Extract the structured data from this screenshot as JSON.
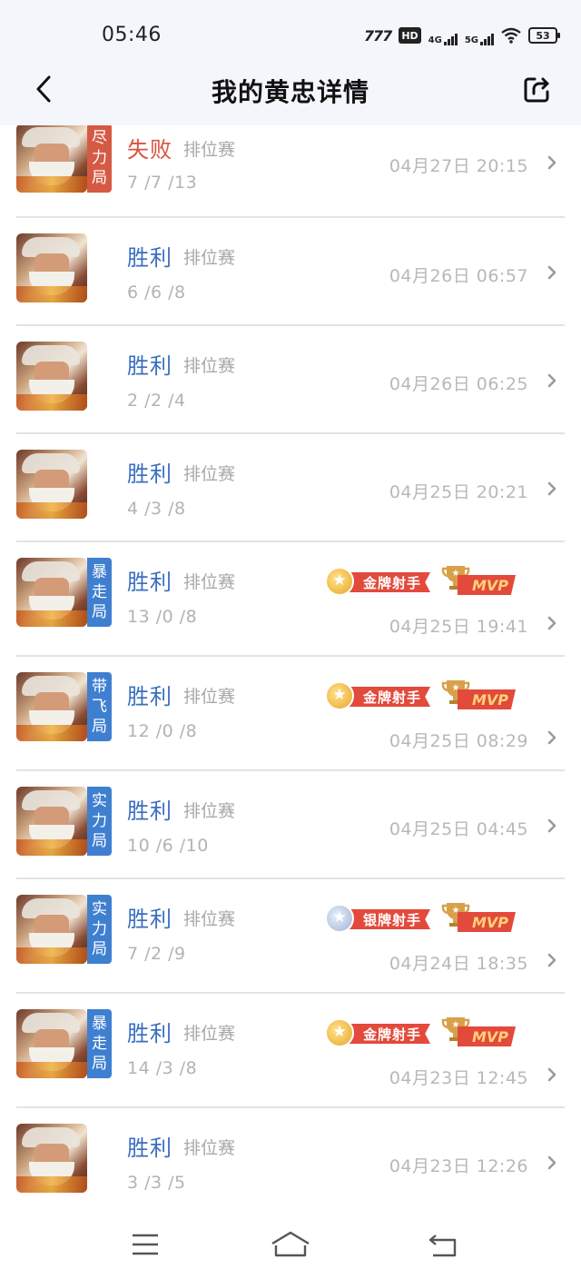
{
  "status_bar": {
    "time": "05:46",
    "carrier": "777",
    "hd": "HD",
    "net1": "4G",
    "net2": "5G",
    "battery": "53"
  },
  "nav": {
    "title": "我的黄忠详情",
    "back_icon": "chevron-left-icon",
    "share_icon": "share-icon"
  },
  "matches": [
    {
      "tag": [
        "尽",
        "力",
        "局"
      ],
      "tag_color": "#d55a44",
      "result": "失败",
      "result_type": "lose",
      "mode": "排位赛",
      "kda": "7 /7 /13",
      "datetime": "04月27日 20:15",
      "medal": null,
      "mvp": false
    },
    {
      "tag": null,
      "result": "胜利",
      "result_type": "win",
      "mode": "排位赛",
      "kda": "6 /6 /8",
      "datetime": "04月26日 06:57",
      "medal": null,
      "mvp": false
    },
    {
      "tag": null,
      "result": "胜利",
      "result_type": "win",
      "mode": "排位赛",
      "kda": "2 /2 /4",
      "datetime": "04月26日 06:25",
      "medal": null,
      "mvp": false
    },
    {
      "tag": null,
      "result": "胜利",
      "result_type": "win",
      "mode": "排位赛",
      "kda": "4 /3 /8",
      "datetime": "04月25日 20:21",
      "medal": null,
      "mvp": false
    },
    {
      "tag": [
        "暴",
        "走",
        "局"
      ],
      "tag_color": "#3f7fd0",
      "result": "胜利",
      "result_type": "win",
      "mode": "排位赛",
      "kda": "13 /0 /8",
      "datetime": "04月25日 19:41",
      "medal": {
        "kind": "gold",
        "label": "金牌射手"
      },
      "mvp": true
    },
    {
      "tag": [
        "带",
        "飞",
        "局"
      ],
      "tag_color": "#3f7fd0",
      "result": "胜利",
      "result_type": "win",
      "mode": "排位赛",
      "kda": "12 /0 /8",
      "datetime": "04月25日 08:29",
      "medal": {
        "kind": "gold",
        "label": "金牌射手"
      },
      "mvp": true
    },
    {
      "tag": [
        "实",
        "力",
        "局"
      ],
      "tag_color": "#3f7fd0",
      "result": "胜利",
      "result_type": "win",
      "mode": "排位赛",
      "kda": "10 /6 /10",
      "datetime": "04月25日 04:45",
      "medal": null,
      "mvp": false
    },
    {
      "tag": [
        "实",
        "力",
        "局"
      ],
      "tag_color": "#3f7fd0",
      "result": "胜利",
      "result_type": "win",
      "mode": "排位赛",
      "kda": "7 /2 /9",
      "datetime": "04月24日 18:35",
      "medal": {
        "kind": "silver",
        "label": "银牌射手"
      },
      "mvp": true
    },
    {
      "tag": [
        "暴",
        "走",
        "局"
      ],
      "tag_color": "#3f7fd0",
      "result": "胜利",
      "result_type": "win",
      "mode": "排位赛",
      "kda": "14 /3 /8",
      "datetime": "04月23日 12:45",
      "medal": {
        "kind": "gold",
        "label": "金牌射手"
      },
      "mvp": true
    },
    {
      "tag": null,
      "result": "胜利",
      "result_type": "win",
      "mode": "排位赛",
      "kda": "3 /3 /5",
      "datetime": "04月23日 12:26",
      "medal": null,
      "mvp": false
    }
  ],
  "mvp_label": "MVP",
  "bottom_nav": {
    "menu_icon": "menu-icon",
    "home_icon": "home-icon",
    "back_icon": "back-icon"
  }
}
